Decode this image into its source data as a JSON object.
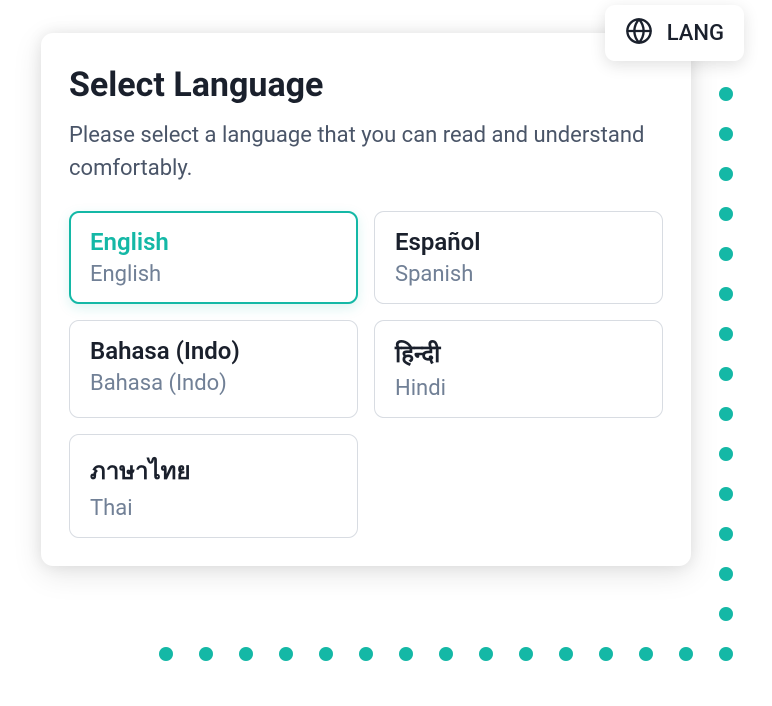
{
  "accent_color": "#14b8a6",
  "card": {
    "title": "Select Language",
    "subtitle": "Please select a language that you can read and understand comfortably."
  },
  "badge": {
    "label": "LANG",
    "icon": "globe-icon"
  },
  "options": [
    {
      "native": "English",
      "english": "English",
      "selected": true
    },
    {
      "native": "Español",
      "english": "Spanish",
      "selected": false
    },
    {
      "native": "Bahasa (Indo)",
      "english": "Bahasa (Indo)",
      "selected": false
    },
    {
      "native": "हिन्दी",
      "english": "Hindi",
      "selected": false
    },
    {
      "native": "ภาษาไทย",
      "english": "Thai",
      "selected": false
    }
  ]
}
